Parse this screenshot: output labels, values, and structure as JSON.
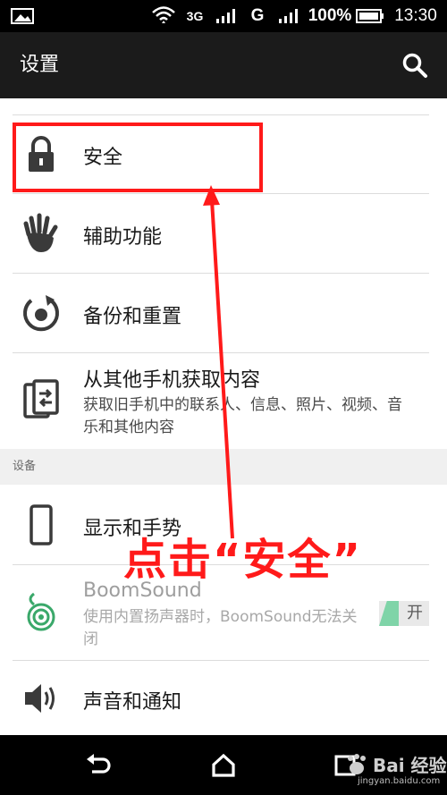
{
  "status_bar": {
    "network": "3G",
    "network2": "G",
    "battery": "100%",
    "time": "13:30"
  },
  "app_bar": {
    "title": "设置",
    "search_icon": "search-icon"
  },
  "items": [
    {
      "id": "security",
      "title": "安全",
      "icon": "lock-icon"
    },
    {
      "id": "accessibility",
      "title": "辅助功能",
      "icon": "hand-icon"
    },
    {
      "id": "backup",
      "title": "备份和重置",
      "icon": "backup-icon"
    },
    {
      "id": "transfer",
      "title": "从其他手机获取内容",
      "subtitle": "获取旧手机中的联系人、信息、照片、视频、音乐和其他内容",
      "icon": "phone-transfer-icon"
    }
  ],
  "section": {
    "label": "设备"
  },
  "device_items": [
    {
      "id": "display",
      "title": "显示和手势",
      "icon": "phone-icon"
    },
    {
      "id": "boomsound",
      "title": "BoomSound",
      "subtitle": "使用内置扬声器时，BoomSound无法关闭",
      "icon": "boomsound-icon",
      "toggle_label": "开"
    },
    {
      "id": "sound",
      "title": "声音和通知",
      "icon": "speaker-icon"
    }
  ],
  "annotation": {
    "text": "点击“安全”",
    "color": "#ff1a1a"
  },
  "watermark": {
    "text": "Bai 经验",
    "url": "jingyan.baidu.com"
  }
}
